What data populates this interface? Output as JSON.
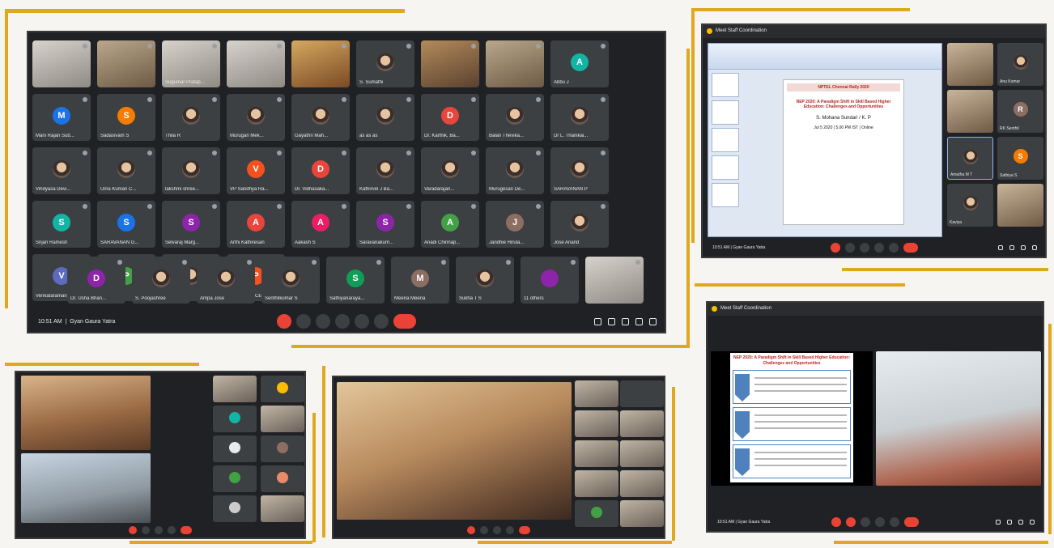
{
  "grid_call": {
    "clock": "10:51 AM",
    "meeting_title": "Gyan Gaura Yatra",
    "row1": [
      {
        "name": "",
        "type": "photo2"
      },
      {
        "name": "",
        "type": "photo"
      },
      {
        "name": "Sugumar Pratap...",
        "type": "photo2"
      },
      {
        "name": "",
        "type": "photo2"
      },
      {
        "name": "",
        "type": "photo4"
      },
      {
        "name": "S. Sumathi",
        "type": "pic"
      },
      {
        "name": "",
        "type": "photo3"
      },
      {
        "name": "",
        "type": "photo"
      },
      {
        "name": "Abbu J",
        "initial": "A",
        "color": "#12b5a5"
      },
      {
        "name": "Mani Rajan Sub...",
        "initial": "M",
        "color": "#1a73e8"
      }
    ],
    "row2": [
      {
        "name": "Sadasivam S",
        "initial": "S",
        "color": "#f57c00"
      },
      {
        "name": "Thila R",
        "type": "pic"
      },
      {
        "name": "Murugan Mek...",
        "type": "pic"
      },
      {
        "name": "Gayathri Mah...",
        "type": "pic"
      },
      {
        "name": "as as as",
        "type": "pic"
      },
      {
        "name": "Dr. Karthik, Ba...",
        "initial": "D",
        "color": "#e8453c"
      },
      {
        "name": "Balan Thevika...",
        "type": "pic"
      },
      {
        "name": "Dr L. Thanikai...",
        "type": "pic"
      },
      {
        "name": "Vihdyasa Devi...",
        "type": "pic"
      },
      {
        "name": "Uma Kumari C...",
        "type": "pic"
      }
    ],
    "row3": [
      {
        "name": "lakshmi shree...",
        "type": "pic"
      },
      {
        "name": "VP Sandhya Ra...",
        "initial": "V",
        "color": "#f4511e"
      },
      {
        "name": "Dr. Vidhasaka...",
        "initial": "D",
        "color": "#e8453c"
      },
      {
        "name": "Kathirvel J Ba...",
        "type": "pic"
      },
      {
        "name": "Varadarajan...",
        "type": "pic"
      },
      {
        "name": "Murugesan De...",
        "type": "pic"
      },
      {
        "name": "SARAVANAN P",
        "type": "pic"
      },
      {
        "name": "Srijan Ramesh",
        "initial": "S",
        "color": "#12b5a5"
      },
      {
        "name": "SARAVANAN G...",
        "initial": "S",
        "color": "#1a73e8"
      },
      {
        "name": "Selvaraj Marg...",
        "initial": "S",
        "color": "#8e24aa"
      }
    ],
    "row4": [
      {
        "name": "Arthi Kathiresan",
        "initial": "A",
        "color": "#e8453c"
      },
      {
        "name": "Aakash S",
        "initial": "A",
        "color": "#e91e63"
      },
      {
        "name": "Saravanakum...",
        "initial": "S",
        "color": "#8e24aa"
      },
      {
        "name": "Anadi Chinnap...",
        "initial": "A",
        "color": "#43a047"
      },
      {
        "name": "Jandhie Hirula...",
        "initial": "J",
        "color": "#8d6e63"
      },
      {
        "name": "Jose Anand",
        "type": "pic"
      },
      {
        "name": "Venkataraman...",
        "initial": "V",
        "color": "#5c6bc0"
      },
      {
        "name": "Praveen V",
        "initial": "P",
        "color": "#43a047"
      },
      {
        "name": "Jose Anand",
        "type": "pic"
      },
      {
        "name": "Professor.ECE...",
        "initial": "P",
        "color": "#f4511e"
      }
    ],
    "row5": [
      {
        "name": "Dr. Usha Bhan...",
        "initial": "D",
        "color": "#8e24aa"
      },
      {
        "name": "S. Poojashree",
        "type": "pic"
      },
      {
        "name": "Ampa Jose",
        "type": "pic"
      },
      {
        "name": "Senthilkumar S",
        "type": "pic"
      },
      {
        "name": "Sathiyanaraya...",
        "initial": "S",
        "color": "#0f9d58"
      },
      {
        "name": "Meena Meena",
        "initial": "M",
        "color": "#8d6e63"
      },
      {
        "name": "Sukha T S",
        "type": "pic"
      },
      {
        "name": "11 others",
        "initial": "",
        "color": "#8e24aa"
      },
      {
        "name": "",
        "type": "photo2"
      }
    ]
  },
  "presentation_call": {
    "window_title": "Meet Staff Coordination",
    "slide_header": "NPTEL Chennai Rally 2020",
    "slide_title": "NEP 2020: A Paradigm Shift in Skill Based Higher Education: Challenges and Opportunities",
    "slide_speaker": "S. Mohana Sundari / K. P",
    "slide_info": "Jul 5 2020 | 5.00 PM IST | Online",
    "clock": "10:51 AM",
    "meeting_title": "Gyan Gaura Yatra",
    "side": [
      {
        "name": "",
        "type": "photo"
      },
      {
        "name": "Anu Kumar",
        "type": "pic"
      },
      {
        "name": "",
        "type": "photo"
      },
      {
        "name": "RK Senthil",
        "initial": "R",
        "color": "#8d6e63"
      },
      {
        "name": "Amutha M T",
        "type": "pic",
        "selected": true
      },
      {
        "name": "Sathiya S",
        "initial": "S",
        "color": "#f57c00"
      },
      {
        "name": "Kaviya",
        "type": "pic"
      },
      {
        "name": "",
        "type": "photo"
      }
    ]
  },
  "speaker_call": {
    "window_title": "Meet Staff Coordination",
    "slide_title": "NEP 2020: A Paradigm Shift in Skill Based Higher Education: Challenges and Opportunities",
    "clock": "10:51 AM",
    "meeting_title": "Gyan Gaura Yatra"
  }
}
